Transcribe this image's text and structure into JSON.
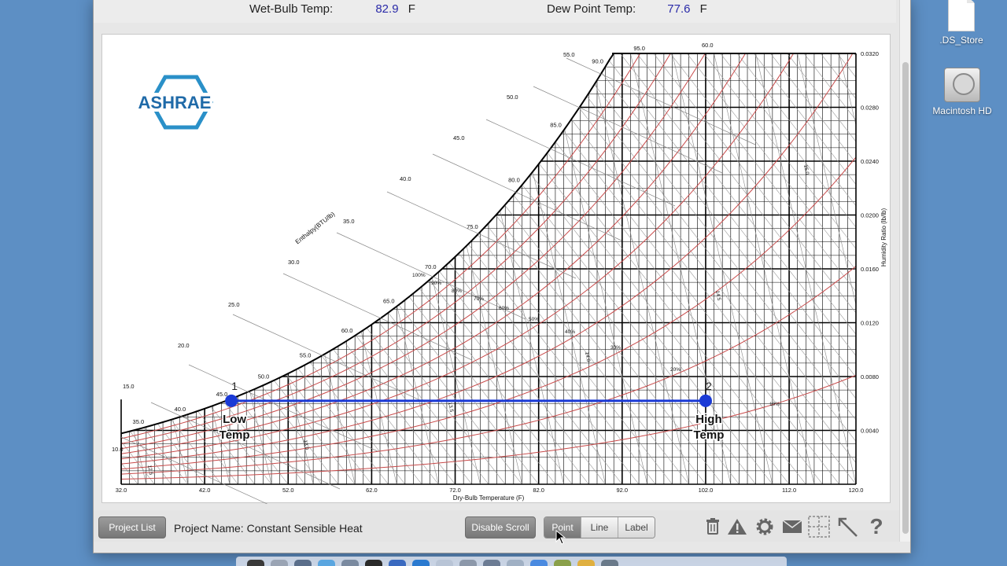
{
  "desktop": {
    "icons": [
      {
        "label": ".DS_Store",
        "icon": "document-icon"
      },
      {
        "label": "Macintosh HD",
        "icon": "hard-drive-icon"
      }
    ]
  },
  "readouts": {
    "wet_bulb_label": "Wet-Bulb Temp:",
    "wet_bulb_value": "82.9",
    "wet_bulb_unit": "F",
    "dew_point_label": "Dew Point Temp:",
    "dew_point_value": "77.6",
    "dew_point_unit": "F"
  },
  "logo": {
    "text": "ASHRAE"
  },
  "chart_data": {
    "type": "psychrometric",
    "xlabel": "Dry-Bulb Temperature (F)",
    "ylabel": "Humidity Ratio (lb/lb)",
    "enthalpy_label": "Enthalpy(BTU/lb)",
    "xlim": [
      32,
      120
    ],
    "ylim": [
      0,
      0.032
    ],
    "x_ticks": [
      "32.0",
      "42.0",
      "52.0",
      "62.0",
      "72.0",
      "82.0",
      "92.0",
      "102.0",
      "112.0",
      "120.0"
    ],
    "y_ticks": [
      "0.0040",
      "0.0080",
      "0.0120",
      "0.0160",
      "0.0200",
      "0.0240",
      "0.0280",
      "0.0320"
    ],
    "saturation_temp_labels": [
      "35.0",
      "40.0",
      "45.0",
      "50.0",
      "55.0",
      "60.0",
      "65.0",
      "70.0",
      "75.0",
      "80.0",
      "85.0",
      "90.0",
      "95.0"
    ],
    "enthalpy_labels": [
      "10.0",
      "15.0",
      "20.0",
      "25.0",
      "30.0",
      "35.0",
      "40.0",
      "45.0",
      "50.0",
      "55.0",
      "60.0"
    ],
    "rh_labels": [
      "100%",
      "90%",
      "80%",
      "70%",
      "60%",
      "50%",
      "40%",
      "30%",
      "20%",
      "10%"
    ],
    "volume_labels": [
      "12.5",
      "13.0",
      "13.5",
      "14.0",
      "14.5",
      "15.0"
    ],
    "points": [
      {
        "id": "1",
        "label": "Low Temp",
        "x": 45.2,
        "y": 0.0062
      },
      {
        "id": "2",
        "label": "High Temp",
        "x": 102,
        "y": 0.0062
      }
    ],
    "process_line": {
      "from": "1",
      "to": "2",
      "color": "#1a3ad6"
    },
    "grid": true
  },
  "toolbar": {
    "project_list": "Project List",
    "project_name": "Project Name: Constant Sensible Heat",
    "disable_scroll": "Disable Scroll",
    "modes": [
      "Point",
      "Line",
      "Label"
    ],
    "active_mode": "Point",
    "icons": [
      "trash-icon",
      "warning-icon",
      "gear-icon",
      "mail-icon",
      "grid-icon",
      "arrow-icon",
      "help-icon"
    ],
    "help_glyph": "?"
  }
}
